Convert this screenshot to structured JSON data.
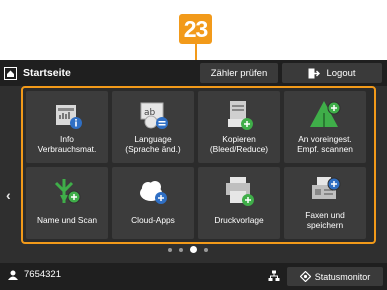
{
  "callout": {
    "number": "23"
  },
  "topbar": {
    "home_label": "Startseite",
    "counter_label": "Zähler prüfen",
    "logout_label": "Logout"
  },
  "tiles": [
    {
      "label": "Info\nVerbrauchsmat.",
      "icon": "info-icon"
    },
    {
      "label": "Language\n(Sprache änd.)",
      "icon": "language-icon"
    },
    {
      "label": "Kopieren\n(Bleed/Reduce)",
      "icon": "copy-icon"
    },
    {
      "label": "An voreingest.\nEmpf. scannen",
      "icon": "scan-preset-icon"
    },
    {
      "label": "Name und Scan",
      "icon": "name-scan-icon"
    },
    {
      "label": "Cloud-Apps",
      "icon": "cloud-icon"
    },
    {
      "label": "Druckvorlage",
      "icon": "print-template-icon"
    },
    {
      "label": "Faxen und\nspeichern",
      "icon": "fax-save-icon"
    }
  ],
  "pagination": {
    "pages": 4,
    "active": 3
  },
  "statusbar": {
    "user_id": "7654321",
    "status_monitor_label": "Statusmonitor"
  },
  "colors": {
    "accent": "#f29a1a",
    "green": "#3fae49",
    "blue": "#2f6fc4"
  }
}
